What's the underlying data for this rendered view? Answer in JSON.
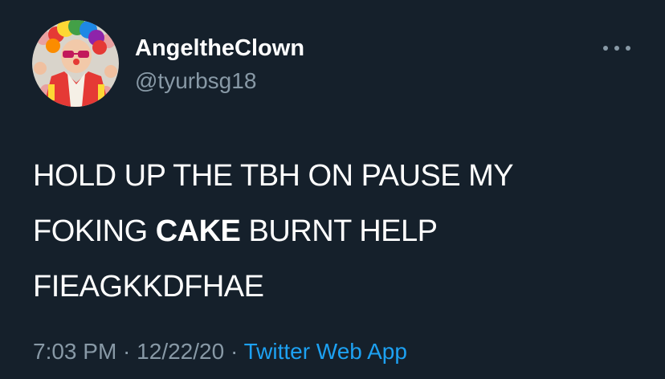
{
  "colors": {
    "background": "#15202b",
    "primary_text": "#ffffff",
    "secondary_text": "#8899a6",
    "link": "#1da1f2"
  },
  "user": {
    "display_name": "AngeltheClown",
    "handle": "@tyurbsg18",
    "avatar_icon": "clown-avatar"
  },
  "more_icon": "more-horizontal-icon",
  "tweet": {
    "line1": "HOLD UP THE TBH ON PAUSE MY",
    "line2_before": "FOKING ",
    "line2_bold": "CAKE",
    "line2_after": " BURNT HELP",
    "line3": "FIEAGKKDFHAE"
  },
  "meta": {
    "time": "7:03 PM",
    "separator": " · ",
    "date": "12/22/20",
    "source": "Twitter Web App"
  }
}
